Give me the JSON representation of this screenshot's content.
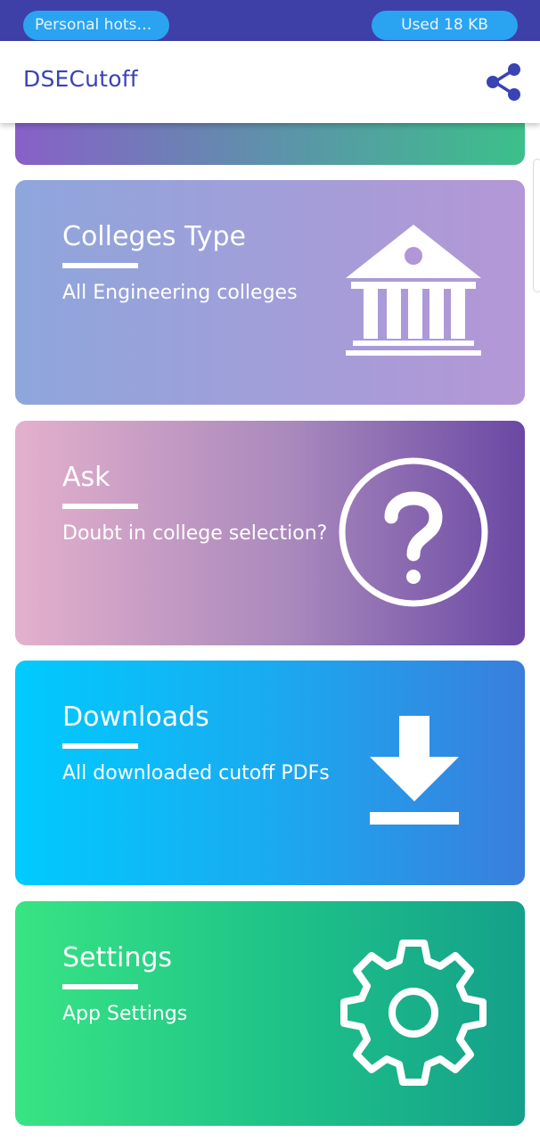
{
  "status": {
    "hotspot": "Personal hotspot…",
    "data_used": "Used  18 KB"
  },
  "appbar": {
    "title": "DSECutoff",
    "share_icon": "share-icon",
    "accent": "#3a43b3"
  },
  "cards": [
    {
      "title": "Colleges Type",
      "subtitle": "All Engineering colleges",
      "icon": "institution-icon"
    },
    {
      "title": "Ask",
      "subtitle": "Doubt in college selection?",
      "icon": "question-circle-icon"
    },
    {
      "title": "Downloads",
      "subtitle": "All downloaded cutoff PDFs",
      "icon": "download-icon"
    },
    {
      "title": "Settings",
      "subtitle": "App Settings",
      "icon": "gear-icon"
    }
  ]
}
